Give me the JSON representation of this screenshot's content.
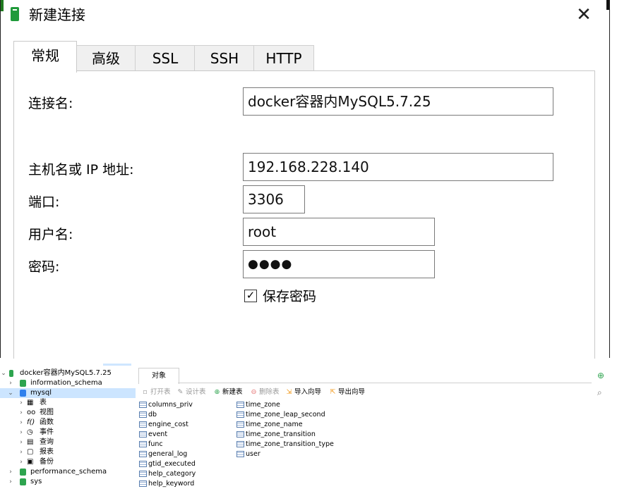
{
  "dialog": {
    "title": "新建连接",
    "close_symbol": "✕",
    "tabs": [
      "常规",
      "高级",
      "SSL",
      "SSH",
      "HTTP"
    ],
    "active_tab": "常规",
    "fields": {
      "connection_name": {
        "label": "连接名:",
        "value": "docker容器内MySQL5.7.25"
      },
      "host": {
        "label": "主机名或 IP 地址:",
        "value": "192.168.228.140"
      },
      "port": {
        "label": "端口:",
        "value": "3306"
      },
      "username": {
        "label": "用户名:",
        "value": "root"
      },
      "password": {
        "label": "密码:",
        "value": "●●●●"
      }
    },
    "save_password": {
      "label": "保存密码",
      "checked": true,
      "check_symbol": "✓"
    }
  },
  "navicat": {
    "tree": {
      "connection": "docker容器内MySQL5.7.25",
      "databases": [
        "information_schema",
        "mysql",
        "performance_schema",
        "sys"
      ],
      "selected_database": "mysql",
      "children": [
        "表",
        "视图",
        "函数",
        "事件",
        "查询",
        "报表",
        "备份"
      ],
      "child_icons": [
        "table-icon",
        "view-icon",
        "function-icon",
        "event-icon",
        "query-icon",
        "report-icon",
        "backup-icon"
      ]
    },
    "object_tab": "对象",
    "toolbar": [
      {
        "label": "打开表",
        "enabled": false,
        "icon": "open-table-icon"
      },
      {
        "label": "设计表",
        "enabled": false,
        "icon": "design-table-icon"
      },
      {
        "label": "新建表",
        "enabled": true,
        "icon": "new-table-icon"
      },
      {
        "label": "删除表",
        "enabled": false,
        "icon": "delete-table-icon"
      },
      {
        "label": "导入向导",
        "enabled": true,
        "icon": "import-wizard-icon"
      },
      {
        "label": "导出向导",
        "enabled": true,
        "icon": "export-wizard-icon"
      }
    ],
    "tables_col1": [
      "columns_priv",
      "db",
      "engine_cost",
      "event",
      "func",
      "general_log",
      "gtid_executed",
      "help_category",
      "help_keyword"
    ],
    "tables_col2": [
      "time_zone",
      "time_zone_leap_second",
      "time_zone_name",
      "time_zone_transition",
      "time_zone_transition_type",
      "user"
    ]
  },
  "colors": {
    "accent_green": "#2ea44f",
    "selection_blue": "#cce5ff"
  }
}
